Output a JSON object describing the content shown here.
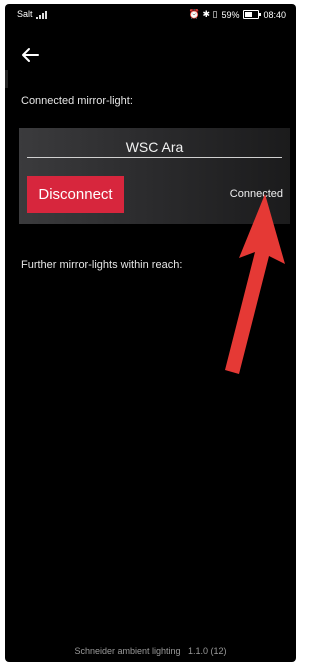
{
  "status_bar": {
    "carrier": "Salt",
    "status_icons": "⏰ ✱ ▯",
    "battery_percent": "59%",
    "time": "08:40"
  },
  "nav": {
    "back_icon": "arrow-left-icon"
  },
  "connected_section": {
    "heading": "Connected mirror-light:"
  },
  "device": {
    "name": "WSC Ara",
    "disconnect_label": "Disconnect",
    "status": "Connected"
  },
  "further_section": {
    "heading": "Further mirror-lights within reach:"
  },
  "footer": {
    "app_name": "Schneider ambient lighting",
    "version": "1.1.0 (12)"
  },
  "colors": {
    "background": "#000000",
    "accent": "#d7263d",
    "annotation_arrow": "#e53935"
  }
}
